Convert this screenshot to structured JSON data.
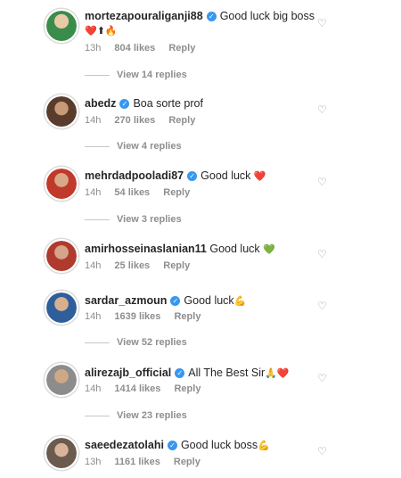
{
  "comments": [
    {
      "username": "mortezapouraliganji88",
      "verified": true,
      "text": "Good luck big boss",
      "emoji": "❤️⬆🔥",
      "time": "13h",
      "likes": "804 likes",
      "reply": "Reply",
      "view_replies": "View 14 replies",
      "avatar_color": "#3a8c4a"
    },
    {
      "username": "abedz",
      "verified": true,
      "text": "Boa sorte prof",
      "emoji": "",
      "time": "14h",
      "likes": "270 likes",
      "reply": "Reply",
      "view_replies": "View 4 replies",
      "avatar_color": "#5a3c2c"
    },
    {
      "username": "mehrdadpooladi87",
      "verified": true,
      "text": "Good luck",
      "emoji": "❤️",
      "time": "14h",
      "likes": "54 likes",
      "reply": "Reply",
      "view_replies": "View 3 replies",
      "avatar_color": "#c0392b"
    },
    {
      "username": "amirhosseinaslanian11",
      "verified": false,
      "text": "Good luck",
      "emoji": "💚",
      "time": "14h",
      "likes": "25 likes",
      "reply": "Reply",
      "view_replies": "",
      "avatar_color": "#b03a2e"
    },
    {
      "username": "sardar_azmoun",
      "verified": true,
      "text": "Good luck",
      "emoji": "💪",
      "time": "14h",
      "likes": "1639 likes",
      "reply": "Reply",
      "view_replies": "View 52 replies",
      "avatar_color": "#2e5f9a"
    },
    {
      "username": "alirezajb_official",
      "verified": true,
      "text": "All The Best Sir",
      "emoji": "🙏❤️",
      "time": "14h",
      "likes": "1414 likes",
      "reply": "Reply",
      "view_replies": "View 23 replies",
      "avatar_color": "#8c8c8c"
    },
    {
      "username": "saeedezatolahi",
      "verified": true,
      "text": "Good luck boss",
      "emoji": "💪",
      "time": "13h",
      "likes": "1161 likes",
      "reply": "Reply",
      "view_replies": "",
      "avatar_color": "#6b5a4e"
    }
  ],
  "icons": {
    "like": "heart-outline"
  },
  "colors": {
    "verified": "#3897f0",
    "muted": "#8e8e8e"
  }
}
